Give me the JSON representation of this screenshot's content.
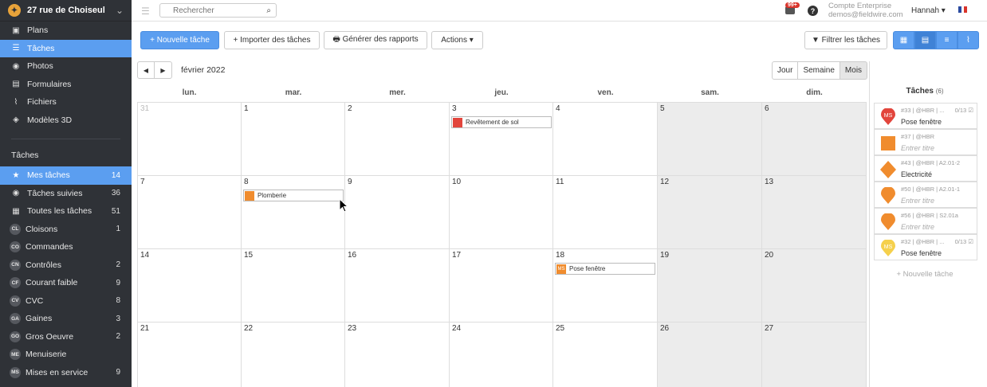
{
  "project": {
    "name": "27 rue de Choiseul"
  },
  "nav_top": [
    {
      "label": "Plans",
      "icon": "plans-icon",
      "glyph": "▣"
    },
    {
      "label": "Tâches",
      "icon": "tasks-icon",
      "glyph": "☰",
      "active": true
    },
    {
      "label": "Photos",
      "icon": "camera-icon",
      "glyph": "◉"
    },
    {
      "label": "Formulaires",
      "icon": "clipboard-icon",
      "glyph": "▤"
    },
    {
      "label": "Fichiers",
      "icon": "paperclip-icon",
      "glyph": "⌇"
    },
    {
      "label": "Modèles 3D",
      "icon": "cube-icon",
      "glyph": "◈"
    }
  ],
  "tasks_section": {
    "title": "Tâches"
  },
  "nav_tasks": [
    {
      "label": "Mes tâches",
      "count": "14",
      "glyph": "★",
      "icon": "star-icon",
      "active": true
    },
    {
      "label": "Tâches suivies",
      "count": "36",
      "glyph": "◉",
      "icon": "eye-icon"
    },
    {
      "label": "Toutes les tâches",
      "count": "51",
      "glyph": "▦",
      "icon": "grid-icon"
    },
    {
      "label": "Cloisons",
      "count": "1",
      "badge": "CL"
    },
    {
      "label": "Commandes",
      "count": "",
      "badge": "CO"
    },
    {
      "label": "Contrôles",
      "count": "2",
      "badge": "CN"
    },
    {
      "label": "Courant faible",
      "count": "9",
      "badge": "CF"
    },
    {
      "label": "CVC",
      "count": "8",
      "badge": "CV"
    },
    {
      "label": "Gaines",
      "count": "3",
      "badge": "GA"
    },
    {
      "label": "Gros Oeuvre",
      "count": "2",
      "badge": "GO"
    },
    {
      "label": "Menuiserie",
      "count": "",
      "badge": "ME"
    },
    {
      "label": "Mises en service",
      "count": "9",
      "badge": "MS"
    }
  ],
  "topbar": {
    "search_placeholder": "Rechercher",
    "notifications": "99+",
    "help": "?",
    "account_type": "Compte Enterprise",
    "account_email": "demos@fieldwire.com",
    "user": "Hannah ▾"
  },
  "toolbar": {
    "new_task": "+ Nouvelle tâche",
    "import": "+ Importer des tâches",
    "reports": "🖶 Générer des rapports",
    "actions": "Actions ▾",
    "filter": "▼ Filtrer les tâches"
  },
  "calendar": {
    "month": "février 2022",
    "prev": "◀",
    "next": "▶",
    "ranges": [
      "Jour",
      "Semaine",
      "Mois"
    ],
    "active_range": "Mois",
    "weekdays": [
      "lun.",
      "mar.",
      "mer.",
      "jeu.",
      "ven.",
      "sam.",
      "dim."
    ],
    "weeks": [
      [
        "31",
        "1",
        "2",
        "3",
        "4",
        "5",
        "6"
      ],
      [
        "7",
        "8",
        "9",
        "10",
        "11",
        "12",
        "13"
      ],
      [
        "14",
        "15",
        "16",
        "17",
        "18",
        "19",
        "20"
      ],
      [
        "21",
        "22",
        "23",
        "24",
        "25",
        "26",
        "27"
      ]
    ],
    "muted_days": [
      "31"
    ],
    "events": [
      {
        "week": 0,
        "day": 3,
        "label": "Revêtement de sol",
        "color": "#e2453c",
        "badge": ""
      },
      {
        "week": 1,
        "day": 1,
        "label": "Plomberie",
        "color": "#f08c2e",
        "badge": ""
      },
      {
        "week": 2,
        "day": 4,
        "label": "Pose fenêtre",
        "color": "#f08c2e",
        "badge": "MS"
      }
    ]
  },
  "panel": {
    "title": "Tâches",
    "count": "(6)",
    "tasks": [
      {
        "meta": "#33 | @HBR | ...",
        "progress": "0/13 ☑",
        "title": "Pose fenêtre",
        "shape": "pin",
        "color": "#e2453c",
        "initials": "MS",
        "placeholder": false
      },
      {
        "meta": "#37 | @HBR",
        "progress": "",
        "title": "Entrer titre",
        "shape": "square",
        "color": "#f08c2e",
        "initials": "",
        "placeholder": true
      },
      {
        "meta": "#43 | @HBR | A2.01-2",
        "progress": "",
        "title": "Electricité",
        "shape": "diamond",
        "color": "#f08c2e",
        "initials": "",
        "placeholder": false
      },
      {
        "meta": "#50 | @HBR | A2.01-1",
        "progress": "",
        "title": "Entrer titre",
        "shape": "pin",
        "color": "#f08c2e",
        "initials": "",
        "placeholder": true
      },
      {
        "meta": "#56 | @HBR | S2.01a",
        "progress": "",
        "title": "Entrer titre",
        "shape": "pin",
        "color": "#f08c2e",
        "initials": "",
        "placeholder": true
      },
      {
        "meta": "#32 | @HBR | ...",
        "progress": "0/13 ☑",
        "title": "Pose fenêtre",
        "shape": "pin",
        "color": "#f5d04c",
        "initials": "MS",
        "placeholder": false
      }
    ],
    "new_task": "+ Nouvelle tâche"
  },
  "colors": {
    "accent": "#5b9ef0",
    "sidebar": "#2f3237"
  }
}
